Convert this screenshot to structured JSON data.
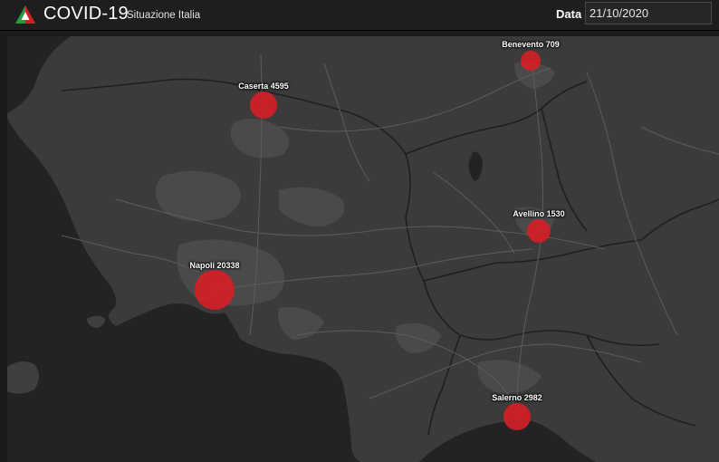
{
  "header": {
    "logo_icon": "italian-flag-triangle-logo",
    "title": "COVID-19",
    "subtitle": "Situazione Italia",
    "date_label": "Data",
    "date_value": "21/10/2020"
  },
  "map": {
    "marker_color": "#d11f26",
    "cities": [
      {
        "name": "Caserta",
        "cases": 4595,
        "label": "Caserta 4595"
      },
      {
        "name": "Benevento",
        "cases": 709,
        "label": "Benevento 709"
      },
      {
        "name": "Avellino",
        "cases": 1530,
        "label": "Avellino 1530"
      },
      {
        "name": "Napoli",
        "cases": 20338,
        "label": "Napoli 20338"
      },
      {
        "name": "Salerno",
        "cases": 2982,
        "label": "Salerno 2982"
      }
    ]
  }
}
